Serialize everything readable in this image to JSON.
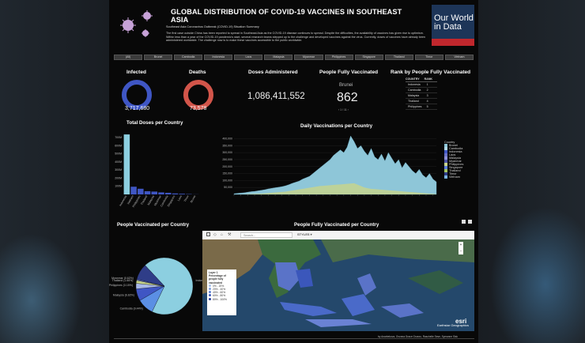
{
  "title": "GLOBAL DISTRIBUTION OF COVID-19 VACCINES IN SOUTHEAST ASIA",
  "logo": {
    "line1": "Our World",
    "line2": "in Data"
  },
  "summary": {
    "heading": "Southeast Asia Coronavirus Outbreak (COVID-19) Situation Summary",
    "text": "The first case outside China has been reported to spread in Southeast Asia as the COVID-19 disease continues to spread. Despite the difficulties, the availability of vaccines has given rise to optimism. Within less than a year of the COVID-19 pandemic's start, several research teams stepped up to the challenge and developed vaccines against the virus. Currently, doses of vaccines have already been administered worldwide. The challenge now is to make these vaccines accessible to the public worldwide."
  },
  "tabs": [
    "(All)",
    "Brunei",
    "Cambodia",
    "Indonesia",
    "Laos",
    "Malaysia",
    "Myanmar",
    "Philippines",
    "Singapore",
    "Thailand",
    "Timor",
    "Vietnam"
  ],
  "kpis": {
    "infected": {
      "label": "Infected",
      "value": "3,717,680"
    },
    "deaths": {
      "label": "Deaths",
      "value": "73,578"
    },
    "doses": {
      "label": "Doses Administered",
      "value": "1,086,411,552"
    },
    "fully": {
      "label": "People Fully Vaccinated",
      "country": "Brunei",
      "value": "862",
      "pager": "‹ 1 / 11 ›"
    }
  },
  "rank": {
    "title": "Rank by People Fully Vaccinated",
    "col1": "COUNTRY",
    "col2": "RANK",
    "rows": [
      [
        "Indonesia",
        "1"
      ],
      [
        "Cambodia",
        "2"
      ],
      [
        "Malaysia",
        "3"
      ],
      [
        "Thailand",
        "4"
      ],
      [
        "Philippines",
        "5"
      ]
    ]
  },
  "chart_data": [
    {
      "type": "bar",
      "title": "Total Doses per Country",
      "categories": [
        "Indonesia",
        "Vietnam",
        "Philippines",
        "Thailand",
        "Malaysia",
        "Myanmar",
        "Cambodia",
        "Singapore",
        "Laos",
        "Timor",
        "Brunei"
      ],
      "values": [
        740,
        95,
        70,
        40,
        35,
        25,
        20,
        12,
        8,
        4,
        1
      ],
      "yticks": [
        "100M",
        "200M",
        "300M",
        "400M",
        "500M",
        "600M",
        "700M"
      ],
      "ylim": [
        0,
        780
      ],
      "colors": {
        "bar": "#8ccfe0",
        "bar2": "#3f56c4"
      }
    },
    {
      "type": "area",
      "title": "Daily Vaccinations per Country",
      "yticks": [
        "50,000",
        "100,000",
        "150,000",
        "200,000",
        "250,000",
        "300,000",
        "350,000",
        "400,000"
      ],
      "ylim": [
        0,
        420000
      ],
      "legend_title": "Country",
      "series": [
        {
          "name": "Brunei",
          "color": "#8ec6d8"
        },
        {
          "name": "Cambodia",
          "color": "#b0d8e8"
        },
        {
          "name": "Indonesia",
          "color": "#3f56c4"
        },
        {
          "name": "Laos",
          "color": "#6a72c9"
        },
        {
          "name": "Malaysia",
          "color": "#8c8fd6"
        },
        {
          "name": "Myanmar",
          "color": "#4a52a4"
        },
        {
          "name": "Philippines",
          "color": "#c9d58a"
        },
        {
          "name": "Singapore",
          "color": "#5c7ed9"
        },
        {
          "name": "Thailand",
          "color": "#a4c560"
        },
        {
          "name": "Timor",
          "color": "#2f3d88"
        },
        {
          "name": "Vietnam",
          "color": "#7ab2e0"
        }
      ],
      "main_values": [
        5000,
        8000,
        10000,
        12000,
        16000,
        20000,
        22000,
        26000,
        30000,
        34000,
        40000,
        44000,
        48000,
        52000,
        56000,
        62000,
        70000,
        80000,
        88000,
        96000,
        110000,
        120000,
        130000,
        150000,
        170000,
        190000,
        210000,
        230000,
        250000,
        280000,
        300000,
        320000,
        300000,
        340000,
        420000,
        380000,
        330000,
        350000,
        310000,
        280000,
        330000,
        270000,
        250000,
        290000,
        240000,
        300000,
        260000,
        220000,
        250000,
        190000,
        230000,
        200000,
        170000,
        150000,
        180000,
        140000,
        120000,
        150000,
        110000,
        90000
      ],
      "second_values": [
        0,
        0,
        0,
        1000,
        2000,
        3000,
        4000,
        5000,
        6000,
        8000,
        10000,
        12000,
        14000,
        16000,
        18000,
        20000,
        24000,
        28000,
        32000,
        36000,
        40000,
        44000,
        48000,
        52000,
        56000,
        60000,
        62000,
        64000,
        66000,
        68000,
        70000,
        72000,
        74000,
        76000,
        78000,
        80000,
        70000,
        60000,
        50000,
        45000,
        40000,
        38000,
        36000,
        34000,
        32000,
        30000,
        28000,
        26000,
        24000,
        22000,
        20000,
        18000,
        16000,
        14000,
        12000,
        10000,
        8000,
        6000,
        4000,
        2000
      ]
    },
    {
      "type": "pie",
      "title": "People Vaccinated per Country",
      "slices": [
        {
          "label": "Indonesia (69.09%)",
          "value": 69.09,
          "color": "#8ccfe0"
        },
        {
          "label": "Cambodia (9.44%)",
          "value": 9.44,
          "color": "#5b8fe4"
        },
        {
          "label": "Malaysia (6.82%)",
          "value": 6.82,
          "color": "#3f56c4"
        },
        {
          "label": "Philippines (3.15%)",
          "value": 3.15,
          "color": "#a8b8e8"
        },
        {
          "label": "Thailand (1.66%)",
          "value": 1.66,
          "color": "#c9d58a"
        },
        {
          "label": "Myanmar (0.62%)",
          "value": 0.62,
          "color": "#7b8ad4"
        },
        {
          "label": "",
          "value": 9.22,
          "color": "#2f3d88"
        }
      ]
    }
  ],
  "map": {
    "title": "People Fully Vaccinated per Country",
    "search_placeholder": "Search...",
    "styles_label": "STYLES ▾",
    "attribution": "Earthstar Geographics",
    "logo": "esri",
    "legend": {
      "layer": "Layer 1",
      "title": "Percentage of people fully vaccinated",
      "items": [
        {
          "label": "0% - 20%",
          "color": "#a8c2ee"
        },
        {
          "label": "20% - 40%",
          "color": "#7f9fe0"
        },
        {
          "label": "40% - 60%",
          "color": "#5b7ed2"
        },
        {
          "label": "60% - 80%",
          "color": "#3e5bbd"
        },
        {
          "label": "80% - 100%",
          "color": "#2b3f9c"
        }
      ]
    }
  },
  "credit": "by Anarbekova, Ovonna Grace Gruezo, Raschelle Sese, Symanne Sisk"
}
